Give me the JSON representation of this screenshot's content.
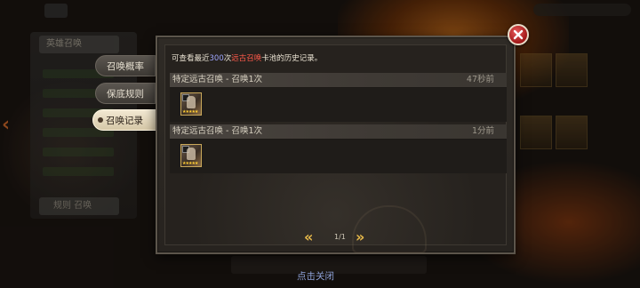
{
  "background": {
    "left_panel_title": "英雄召唤",
    "left_panel_button": "规则 召唤"
  },
  "tabs": [
    {
      "label": "召唤概率",
      "active": false
    },
    {
      "label": "保底规则",
      "active": false
    },
    {
      "label": "召唤记录",
      "active": true
    }
  ],
  "popup": {
    "notice": {
      "prefix": "可查看最近",
      "count": "300",
      "middle": "次",
      "pool": "远古召唤",
      "suffix": "卡池的历史记录。"
    },
    "records": [
      {
        "title": "特定远古召唤 - 召唤1次",
        "time": "47秒前",
        "hero_icon": "hero-portrait-icon",
        "stars": "★★★★★"
      },
      {
        "title": "特定远古召唤 - 召唤1次",
        "time": "1分前",
        "hero_icon": "hero-portrait-icon",
        "stars": "★★★★★"
      }
    ],
    "pager": {
      "prev": "«",
      "page": "1/1",
      "next": "»"
    }
  },
  "close_icon": "close-x-icon",
  "click_to_close": "点击关闭",
  "colors": {
    "highlight_count": "#9fa7ff",
    "highlight_pool": "#ff5a4a",
    "pager_arrow": "#e7b94a",
    "close_red": "#c02020"
  }
}
